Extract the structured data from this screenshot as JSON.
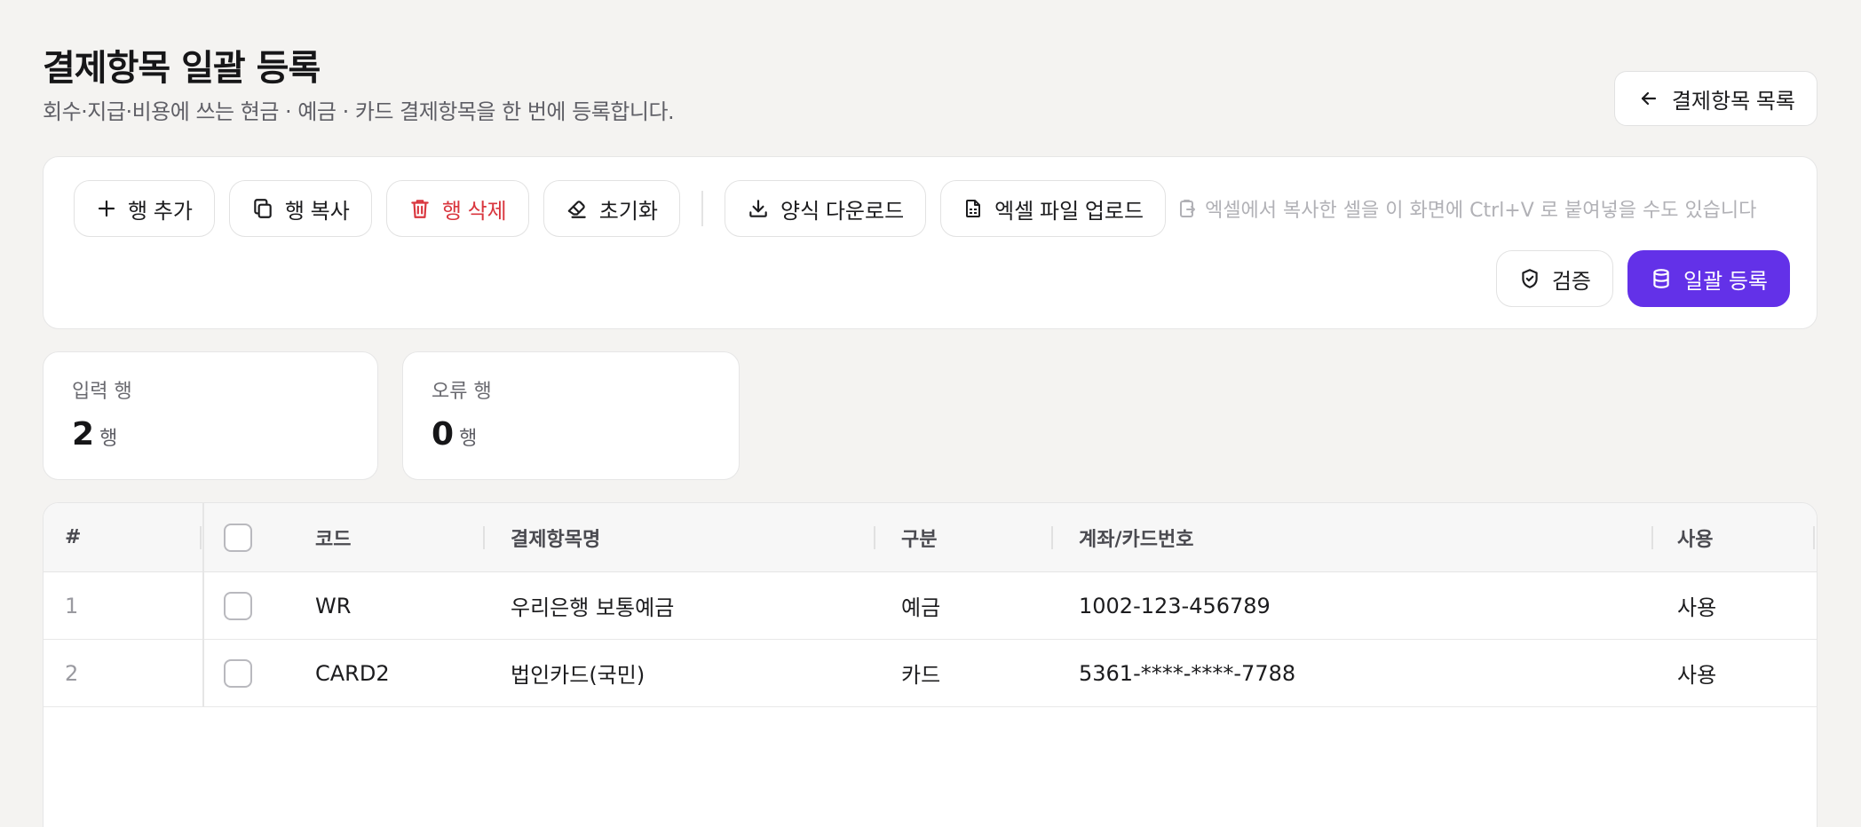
{
  "header": {
    "title": "결제항목 일괄 등록",
    "subtitle": "회수·지급·비용에 쓰는 현금 · 예금 · 카드 결제항목을 한 번에 등록합니다.",
    "back_label": "결제항목 목록"
  },
  "toolbar": {
    "add_row": "행 추가",
    "copy_row": "행 복사",
    "delete_row": "행 삭제",
    "reset": "초기화",
    "download_template": "양식 다운로드",
    "upload_excel": "엑셀 파일 업로드",
    "paste_hint": "엑셀에서 복사한 셀을 이 화면에 Ctrl+V 로 붙여넣을 수도 있습니다",
    "validate": "검증",
    "bulk_register": "일괄 등록"
  },
  "stats": {
    "input_label": "입력 행",
    "input_count": "2",
    "input_unit": "행",
    "error_label": "오류 행",
    "error_count": "0",
    "error_unit": "행"
  },
  "table": {
    "headers": {
      "num": "#",
      "code": "코드",
      "name": "결제항목명",
      "type": "구분",
      "account": "계좌/카드번호",
      "use": "사용"
    },
    "rows": [
      {
        "num": "1",
        "code": "WR",
        "name": "우리은행 보통예금",
        "type": "예금",
        "account": "1002-123-456789",
        "use": "사용"
      },
      {
        "num": "2",
        "code": "CARD2",
        "name": "법인카드(국민)",
        "type": "카드",
        "account": "5361-****-****-7788",
        "use": "사용"
      }
    ]
  },
  "colors": {
    "primary": "#6331e8",
    "danger": "#d9363e",
    "background": "#f4f3f1"
  }
}
